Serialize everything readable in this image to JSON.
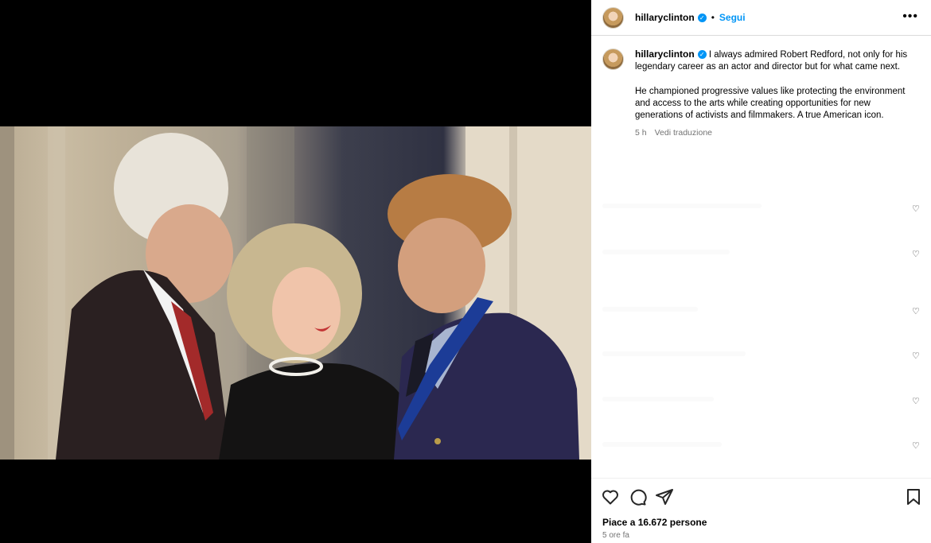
{
  "post": {
    "username": "hillaryclinton",
    "follow_label": "Segui",
    "more_label": "•••",
    "caption_p1": "I always admired Robert Redford, not only for his legendary career as an actor and director but for what came next.",
    "caption_p2": "He championed progressive values like protecting the environment and access to the arts while creating opportunities for new generations of activists and filmmakers. A true American icon.",
    "time": "5 h",
    "translate_label": "Vedi traduzione",
    "likes": "Piace a 16.672 persone",
    "time_ago": "5 ore fa"
  },
  "icons": {
    "verified": "verified-badge-icon",
    "like": "heart-icon",
    "comment": "comment-bubble-icon",
    "share": "paper-plane-icon",
    "save": "bookmark-icon"
  },
  "colors": {
    "accent": "#0095f6",
    "text_secondary": "#737373",
    "border": "#dbdbdb"
  }
}
